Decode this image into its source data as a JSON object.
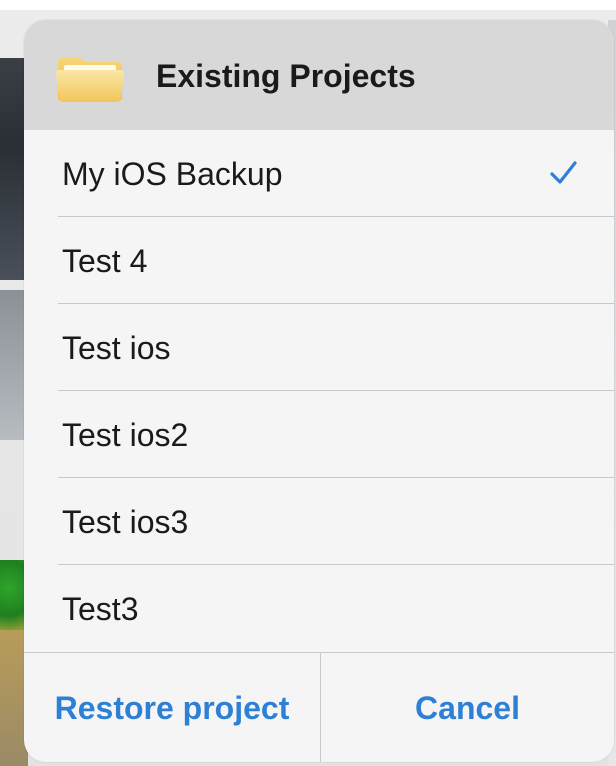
{
  "dialog": {
    "title": "Existing Projects",
    "icon": "folder-icon"
  },
  "projects": [
    {
      "label": "My iOS Backup",
      "selected": true
    },
    {
      "label": "Test 4",
      "selected": false
    },
    {
      "label": "Test ios",
      "selected": false
    },
    {
      "label": "Test ios2",
      "selected": false
    },
    {
      "label": "Test ios3",
      "selected": false
    },
    {
      "label": "Test3",
      "selected": false
    }
  ],
  "actions": {
    "restore_label": "Restore project",
    "cancel_label": "Cancel"
  },
  "colors": {
    "accent": "#2e7fd6",
    "header_bg": "#d8d8d8",
    "separator": "#c9c9c9"
  }
}
